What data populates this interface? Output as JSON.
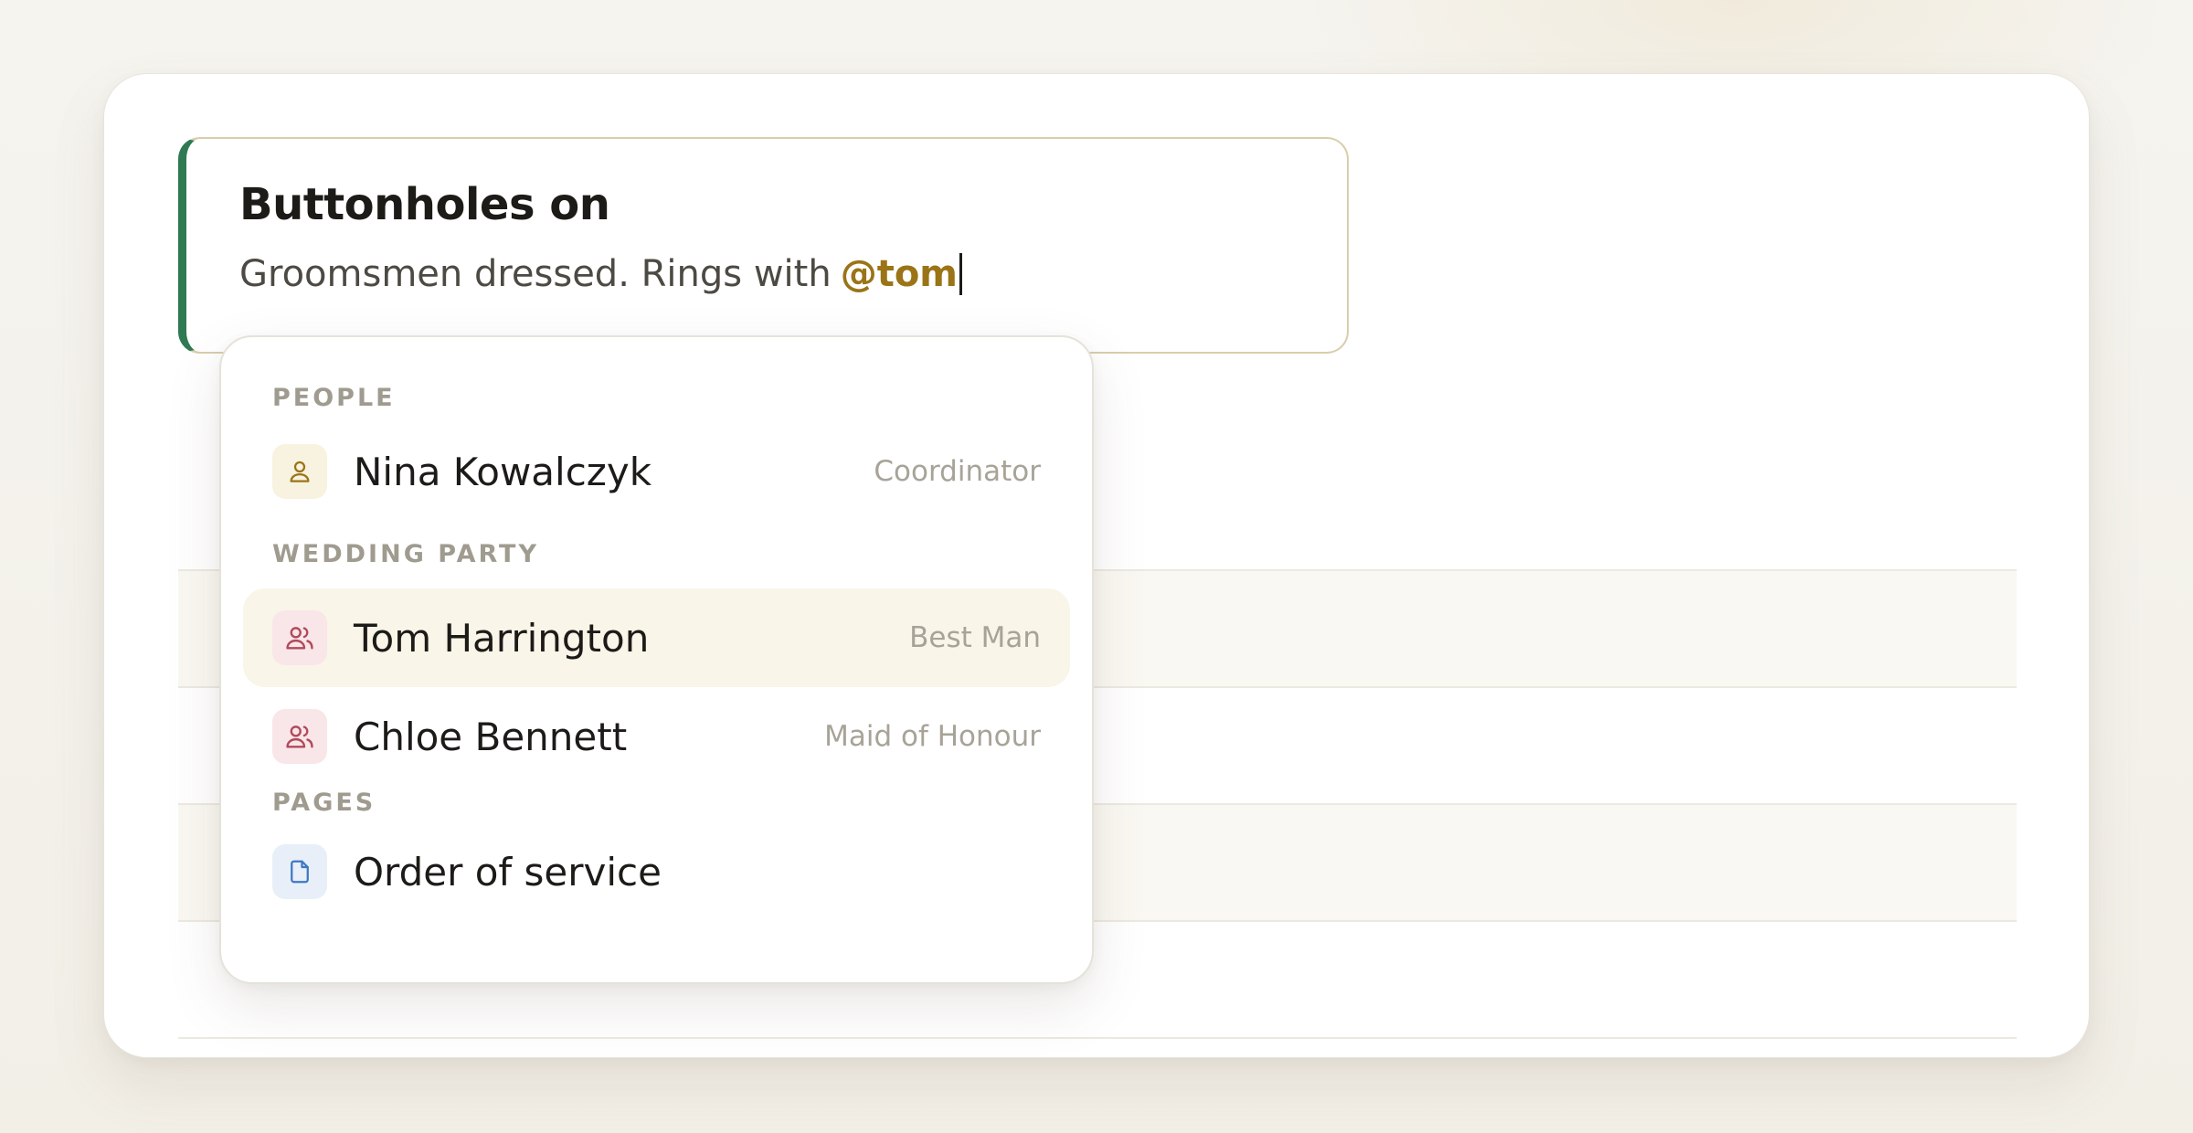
{
  "note": {
    "title": "Buttonholes on",
    "body_text": "Groomsmen dressed. Rings with",
    "mention": "@tom"
  },
  "dropdown": {
    "sections": [
      {
        "label": "PEOPLE",
        "items": [
          {
            "name": "Nina Kowalczyk",
            "role": "Coordinator",
            "icon": "person-icon"
          }
        ]
      },
      {
        "label": "WEDDING PARTY",
        "items": [
          {
            "name": "Tom Harrington",
            "role": "Best Man",
            "icon": "users-icon",
            "active": true
          },
          {
            "name": "Chloe Bennett",
            "role": "Maid of Honour",
            "icon": "users-icon"
          }
        ]
      },
      {
        "label": "PAGES",
        "items": [
          {
            "name": "Order of service",
            "role": "",
            "icon": "document-icon"
          }
        ]
      }
    ]
  },
  "colors": {
    "accent_green": "#2f7a52",
    "mention_gold": "#9a7416",
    "active_row": "#f9f5e8"
  }
}
